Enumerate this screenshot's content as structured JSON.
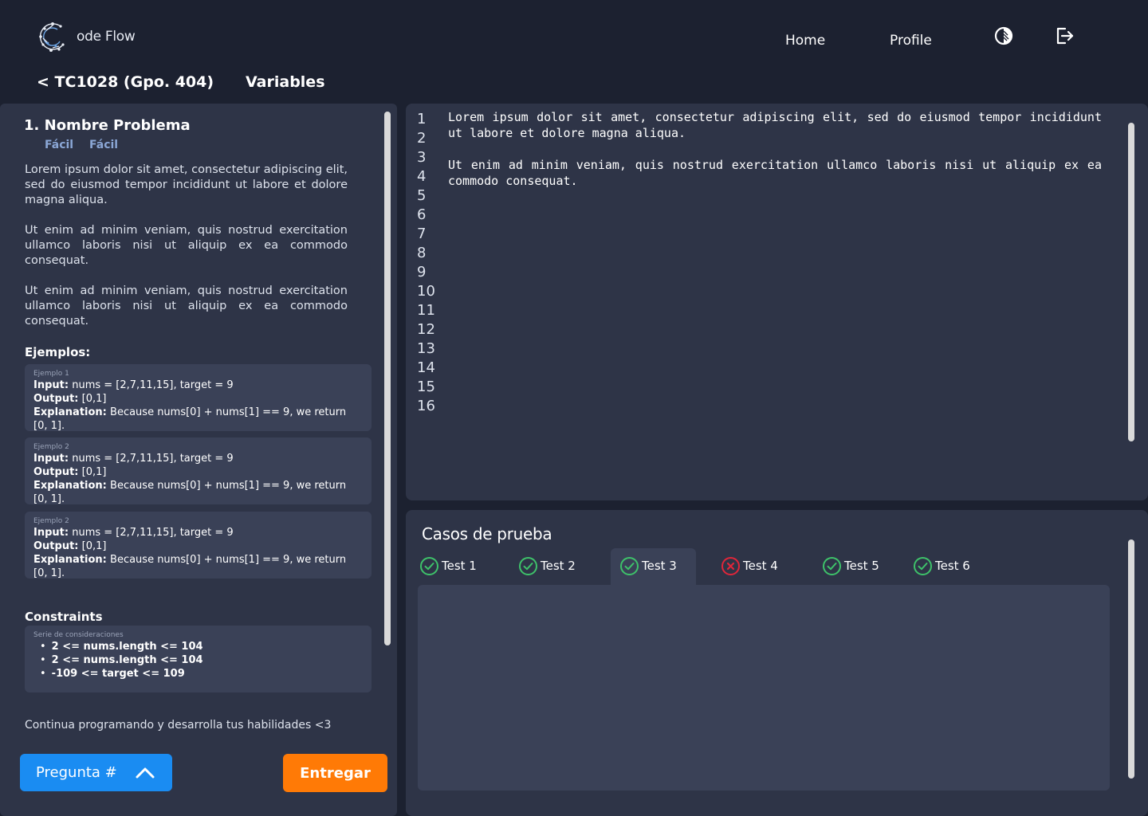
{
  "app": {
    "logo_text": "ode Flow"
  },
  "nav": {
    "home": "Home",
    "profile": "Profile"
  },
  "header": {
    "breadcrumb": "< TC1028 (Gpo. 404)",
    "title": "Variables"
  },
  "problem": {
    "title": "1. Nombre Problema",
    "difficulty": [
      "Fácil",
      "Fácil"
    ],
    "paragraphs": [
      "Lorem ipsum dolor sit amet, consectetur adipiscing elit, sed do eiusmod tempor incididunt ut labore et dolore magna aliqua.",
      "Ut enim ad minim veniam, quis nostrud exercitation ullamco laboris nisi ut aliquip ex ea commodo consequat.",
      "Ut enim ad minim veniam, quis nostrud exercitation ullamco laboris nisi ut aliquip ex ea commodo consequat."
    ],
    "examples_heading": "Ejemplos:",
    "examples": [
      {
        "label": "Ejemplo 1",
        "input_label": "Input:",
        "input": " nums = [2,7,11,15], target = 9",
        "output_label": "Output:",
        "output": " [0,1]",
        "explanation_label": "Explanation:",
        "explanation": " Because nums[0] + nums[1] == 9, we return [0, 1]."
      },
      {
        "label": "Ejemplo 2",
        "input_label": "Input:",
        "input": " nums = [2,7,11,15], target = 9",
        "output_label": "Output:",
        "output": " [0,1]",
        "explanation_label": "Explanation:",
        "explanation": " Because nums[0] + nums[1] == 9, we return [0, 1]."
      },
      {
        "label": "Ejemplo 2",
        "input_label": "Input:",
        "input": " nums = [2,7,11,15], target = 9",
        "output_label": "Output:",
        "output": " [0,1]",
        "explanation_label": "Explanation:",
        "explanation": " Because nums[0] + nums[1] == 9, we return [0, 1]."
      }
    ],
    "constraints_heading": "Constraints",
    "constraints_label": "Serie de consideraciones",
    "constraints": [
      "2 <= nums.length <= 104",
      "2 <= nums.length <= 104",
      "-109 <= target <= 109"
    ],
    "footer": "Continua programando y desarrolla tus habilidades <3"
  },
  "buttons": {
    "question": "Pregunta #",
    "submit": "Entregar"
  },
  "editor": {
    "line_numbers": [
      "1",
      "2",
      "3",
      "4",
      "5",
      "6",
      "7",
      "8",
      "9",
      "10",
      "11",
      "12",
      "13",
      "14",
      "15",
      "16"
    ],
    "code_lines": [
      "Lorem ipsum dolor sit amet, consectetur adipiscing elit, sed do eiusmod tempor incididunt ut labore et dolore magna aliqua.",
      "Ut enim ad minim veniam, quis nostrud exercitation ullamco laboris nisi ut aliquip ex ea commodo consequat."
    ]
  },
  "tests": {
    "title": "Casos de prueba",
    "tabs": [
      {
        "label": "Test 1",
        "status": "pass"
      },
      {
        "label": "Test 2",
        "status": "pass"
      },
      {
        "label": "Test 3",
        "status": "pass"
      },
      {
        "label": "Test 4",
        "status": "fail"
      },
      {
        "label": "Test 5",
        "status": "pass"
      },
      {
        "label": "Test 6",
        "status": "pass"
      }
    ]
  },
  "colors": {
    "background": "#1c2130",
    "panel": "#2e3447",
    "card": "#3a4157",
    "pass": "#3ec26a",
    "fail": "#e0263a",
    "primary_button": "#1a8cf2",
    "submit_button": "#ff7a06"
  }
}
